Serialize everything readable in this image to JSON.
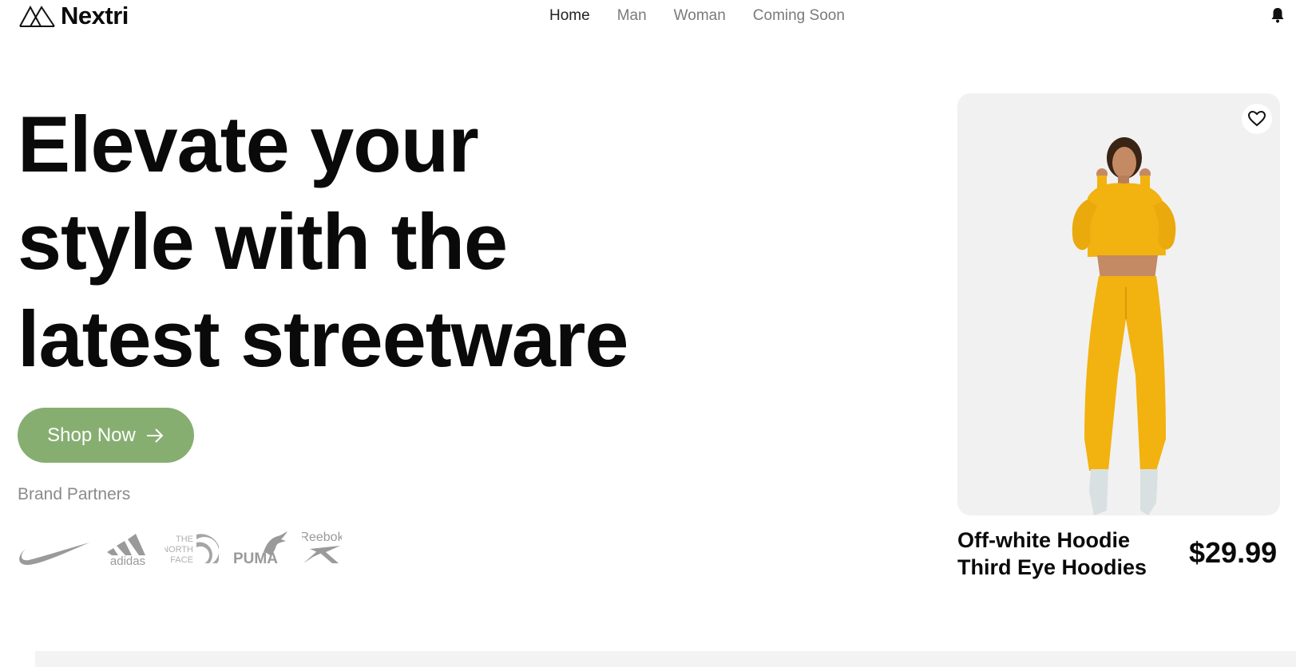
{
  "header": {
    "brand": "Nextri",
    "nav": [
      {
        "label": "Home",
        "active": true
      },
      {
        "label": "Man",
        "active": false
      },
      {
        "label": "Woman",
        "active": false
      },
      {
        "label": "Coming Soon",
        "active": false
      }
    ],
    "notification_icon": "bell-icon"
  },
  "hero": {
    "headline_lines": [
      "Elevate your",
      "style with the",
      "latest streetware"
    ],
    "cta_label": "Shop Now",
    "cta_icon": "arrow-right-icon",
    "cta_color": "#87ae71",
    "partners_label": "Brand Partners",
    "partners": [
      "Nike",
      "adidas",
      "The North Face",
      "Puma",
      "Reebok"
    ]
  },
  "product": {
    "name_lines": [
      "Off-white Hoodie",
      "Third Eye Hoodies"
    ],
    "price": "$29.99",
    "favorite_icon": "heart-icon",
    "garment_color": "#f2b20f"
  }
}
